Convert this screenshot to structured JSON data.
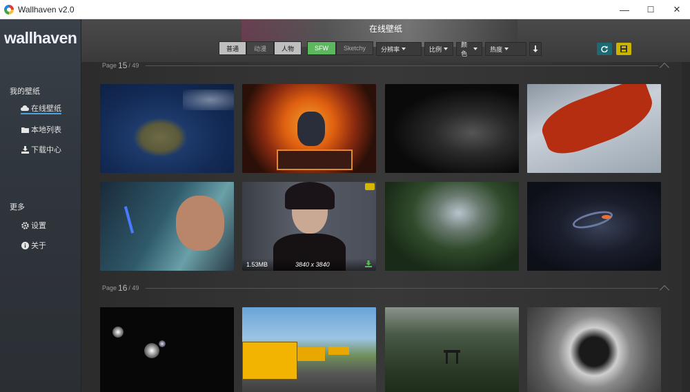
{
  "window": {
    "title": "Wallhaven v2.0",
    "minimize": "—",
    "maximize": "☐",
    "close": "✕"
  },
  "sidebar": {
    "brand": "wallhaven",
    "my_wallpapers_title": "我的壁纸",
    "items": [
      {
        "label": "在线壁纸",
        "icon": "cloud-icon",
        "active": true
      },
      {
        "label": "本地列表",
        "icon": "folder-icon",
        "active": false
      },
      {
        "label": "下载中心",
        "icon": "download-icon",
        "active": false
      }
    ],
    "more_title": "更多",
    "more_items": [
      {
        "label": "设置",
        "icon": "gear-icon"
      },
      {
        "label": "关于",
        "icon": "info-icon"
      }
    ]
  },
  "header": {
    "title": "在线壁纸"
  },
  "toolbar": {
    "category": {
      "general": "普通",
      "anime": "动漫",
      "people": "人物"
    },
    "purity": {
      "sfw": "SFW",
      "sketchy": "Sketchy"
    },
    "resolution": "分辨率",
    "ratio": "比例",
    "color": "颜色",
    "sort": "热度",
    "sort_direction_icon": "arrow-down-icon",
    "refresh_icon": "refresh-icon",
    "save_icon": "save-icon",
    "colors": {
      "refresh_bg": "#1d6a72",
      "save_bg": "#c9b400",
      "sfw_green": "#5cb85c"
    }
  },
  "pages": [
    {
      "prefix": "Page",
      "number": "15",
      "total": "/ 49"
    },
    {
      "prefix": "Page",
      "number": "16",
      "total": "/ 49"
    }
  ],
  "thumbnail": {
    "size": "1.53MB",
    "resolution": "3840 x 3840"
  }
}
